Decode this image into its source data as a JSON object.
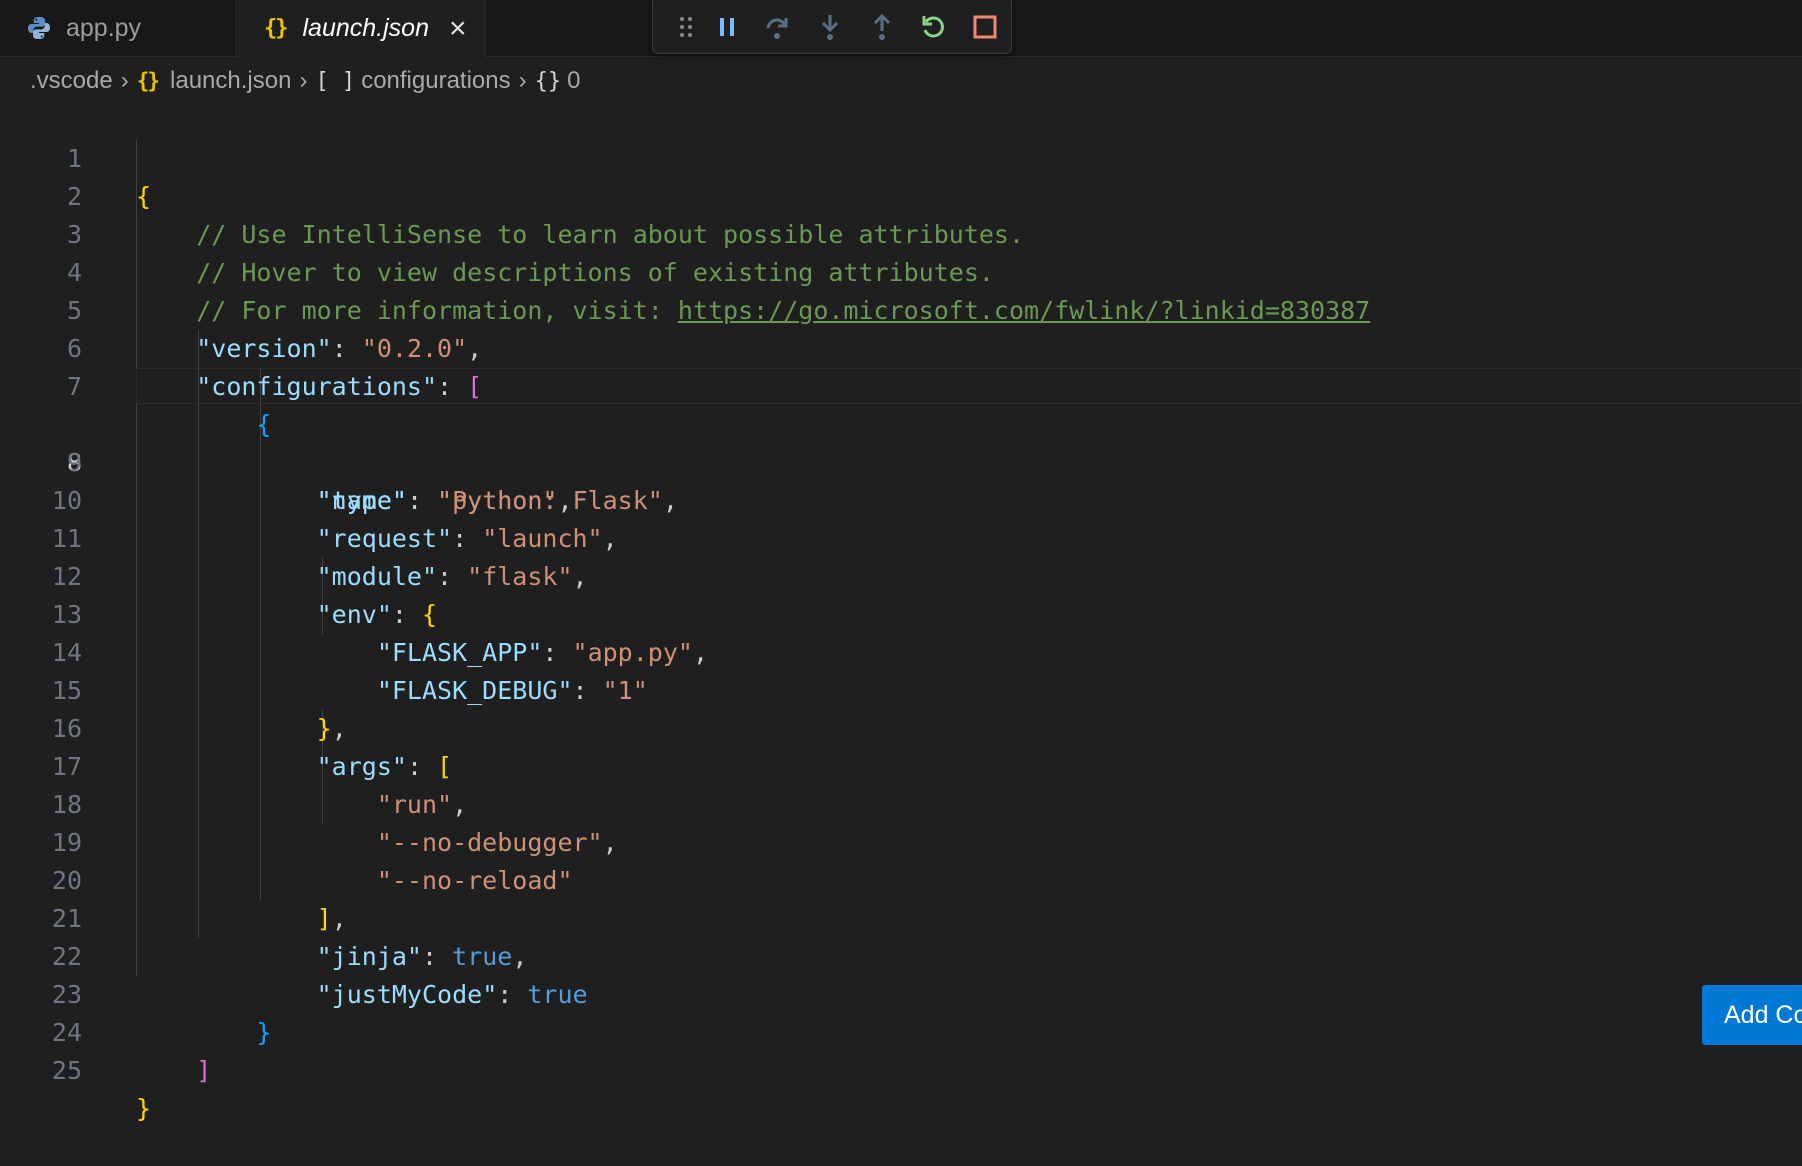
{
  "tabs": [
    {
      "label": "app.py",
      "icon": "python-icon",
      "active": false
    },
    {
      "label": "launch.json",
      "icon": "json-braces-icon",
      "active": true,
      "close_icon": "×"
    }
  ],
  "debug_toolbar": [
    "drag-handle-icon",
    "pause-icon",
    "step-over-icon",
    "step-into-icon",
    "step-out-icon",
    "restart-icon",
    "stop-icon"
  ],
  "breadcrumb": {
    "folder": ".vscode",
    "file_icon": "{}",
    "file": "launch.json",
    "array_icon": "[ ]",
    "array": "configurations",
    "object_icon": "{}",
    "object": "0"
  },
  "editor": {
    "current_line": 8,
    "line_numbers": [
      "1",
      "2",
      "3",
      "4",
      "5",
      "6",
      "7",
      "8",
      "9",
      "10",
      "11",
      "12",
      "13",
      "14",
      "15",
      "16",
      "17",
      "18",
      "19",
      "20",
      "21",
      "22",
      "23",
      "24",
      "25"
    ],
    "tokens": {
      "open1": "{",
      "com1": "// Use IntelliSense to learn about possible attributes.",
      "com2": "// Hover to view descriptions of existing attributes.",
      "com3": "// For more information, visit: ",
      "link": "https://go.microsoft.com/fwlink/?linkid=830387",
      "k_version": "\"version\"",
      "v_version": "\"0.2.0\"",
      "k_configurations": "\"configurations\"",
      "open_arr": "[",
      "open2": "{",
      "k_name": "\"name\"",
      "v_name": "\"Python: Flask\"",
      "k_type": "\"type\"",
      "v_type": "\"python\"",
      "k_request": "\"request\"",
      "v_request": "\"launch\"",
      "k_module": "\"module\"",
      "v_module": "\"flask\"",
      "k_env": "\"env\"",
      "open3": "{",
      "k_flask_app": "\"FLASK_APP\"",
      "v_flask_app": "\"app.py\"",
      "k_flask_debug": "\"FLASK_DEBUG\"",
      "v_flask_debug": "\"1\"",
      "close3": "}",
      "k_args": "\"args\"",
      "open_arr2": "[",
      "v_run": "\"run\"",
      "v_no_debugger": "\"--no-debugger\"",
      "v_no_reload": "\"--no-reload\"",
      "close_arr2": "]",
      "k_jinja": "\"jinja\"",
      "v_jinja": "true",
      "k_justmycode": "\"justMyCode\"",
      "v_justmycode": "true",
      "close2": "}",
      "close_arr": "]",
      "close1": "}"
    }
  },
  "add_configuration_button": "Add Co",
  "colors": {
    "comment": "#6a9955",
    "key": "#9cdcfe",
    "string": "#ce9178",
    "bracket_gold": "#ffd700",
    "bracket_orchid": "#da70d6",
    "bracket_blue": "#179fff",
    "boolean": "#569cd6",
    "button_blue": "#0078d4"
  }
}
